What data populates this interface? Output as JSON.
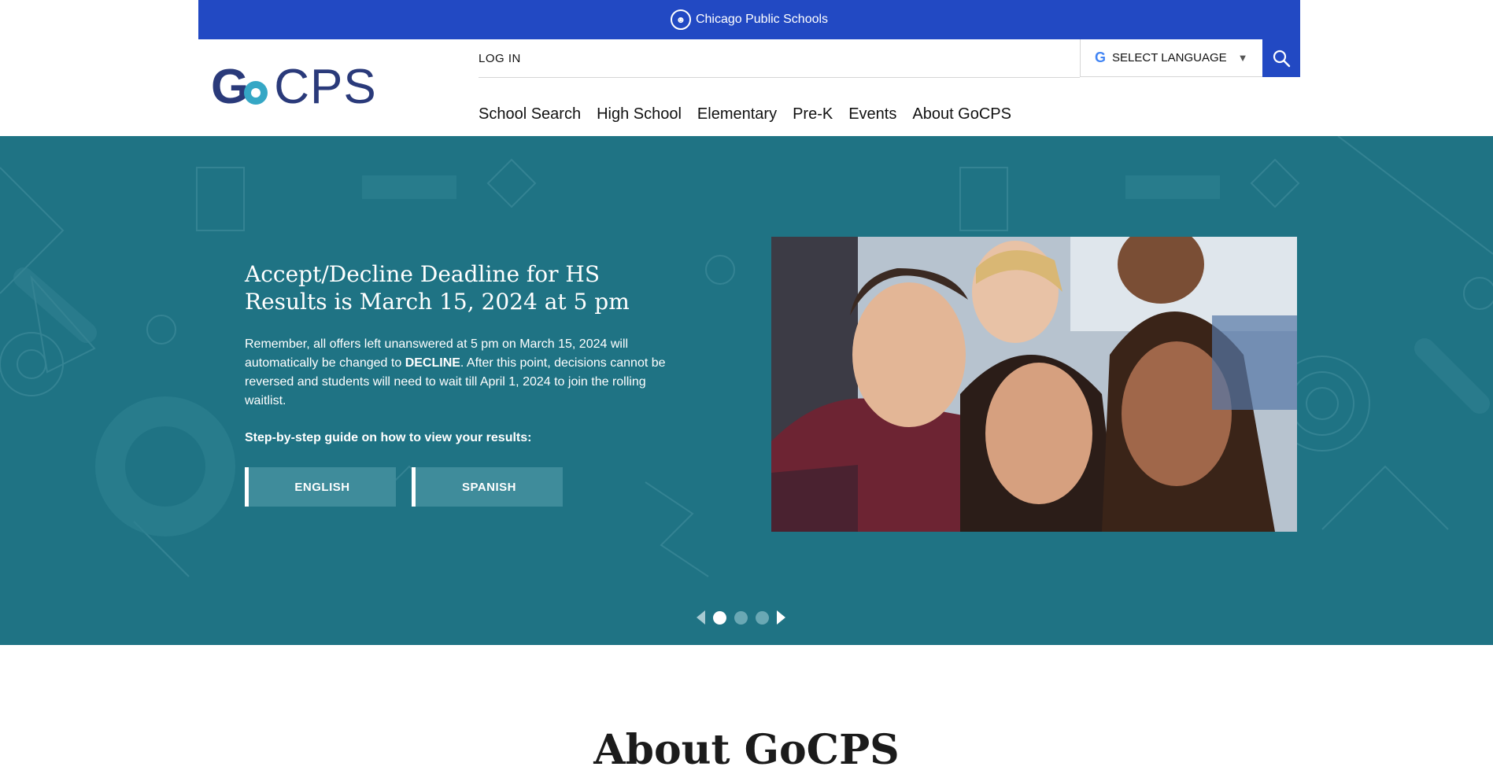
{
  "topbar": {
    "brand": "Chicago Public Schools",
    "icon": "cps-family-icon"
  },
  "header": {
    "logo_g": "G",
    "logo_cps": "CPS",
    "login_label": "LOG IN",
    "language_label": "SELECT LANGUAGE",
    "nav": [
      "School Search",
      "High School",
      "Elementary",
      "Pre-K",
      "Events",
      "About GoCPS"
    ]
  },
  "hero": {
    "title": "Accept/Decline Deadline for HS Results is March 15, 2024 at 5 pm",
    "body_part1": "Remember, all offers left unanswered at 5 pm on March 15, 2024 will automatically be changed to ",
    "body_bold": "DECLINE",
    "body_part2": ". After this point, decisions cannot be reversed and students will need to wait till April 1, 2024 to join the rolling waitlist.",
    "guide": "Step-by-step guide on how to view your results:",
    "button_english": "ENGLISH",
    "button_spanish": "SPANISH",
    "slides_total": 3,
    "slide_active": 1
  },
  "about": {
    "title": "About GoCPS"
  },
  "colors": {
    "blue": "#2249c3",
    "teal": "#1f7384",
    "navy": "#2a3a7a",
    "cyan": "#35a7c5"
  }
}
